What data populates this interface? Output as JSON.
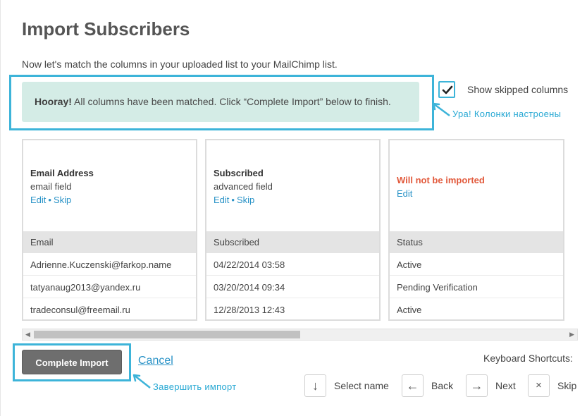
{
  "page": {
    "title": "Import Subscribers",
    "intro": "Now let's match the columns in your uploaded list to your MailChimp list."
  },
  "banner": {
    "strong": "Hooray!",
    "text": " All columns have been matched. Click “Complete Import” below to finish."
  },
  "options": {
    "show_skipped_label": "Show skipped columns",
    "show_skipped_checked": true
  },
  "annotations": {
    "banner_note": "Ура! Колонки настроены",
    "complete_note": "Завершить импорт",
    "color": "#3db4d9"
  },
  "columns": [
    {
      "name": "Email Address",
      "type": "email field",
      "edit": "Edit",
      "sep": "•",
      "skip": "Skip",
      "header": "Email",
      "rows": [
        "Adrienne.Kuczenski@farkop.name",
        "tatyanaug2013@yandex.ru",
        "tradeconsul@freemail.ru"
      ]
    },
    {
      "name": "Subscribed",
      "type": "advanced field",
      "edit": "Edit",
      "sep": "•",
      "skip": "Skip",
      "header": "Subscribed",
      "rows": [
        "04/22/2014 03:58",
        "03/20/2014 09:34",
        "12/28/2013 12:43"
      ]
    },
    {
      "status": "Will not be imported",
      "edit": "Edit",
      "header": "Status",
      "rows": [
        "Active",
        "Pending Verification",
        "Active"
      ]
    }
  ],
  "actions": {
    "complete": "Complete Import",
    "cancel": "Cancel"
  },
  "shortcuts": {
    "title": "Keyboard Shortcuts:",
    "items": [
      {
        "key": "↓",
        "label": "Select name"
      },
      {
        "key": "←",
        "label": "Back"
      },
      {
        "key": "→",
        "label": "Next"
      },
      {
        "key": "×",
        "label": "Skip"
      }
    ]
  },
  "colors": {
    "banner_bg": "#d4ece6",
    "link": "#2a93c7",
    "warning": "#e25a3c",
    "button_bg": "#6e6e6e"
  }
}
